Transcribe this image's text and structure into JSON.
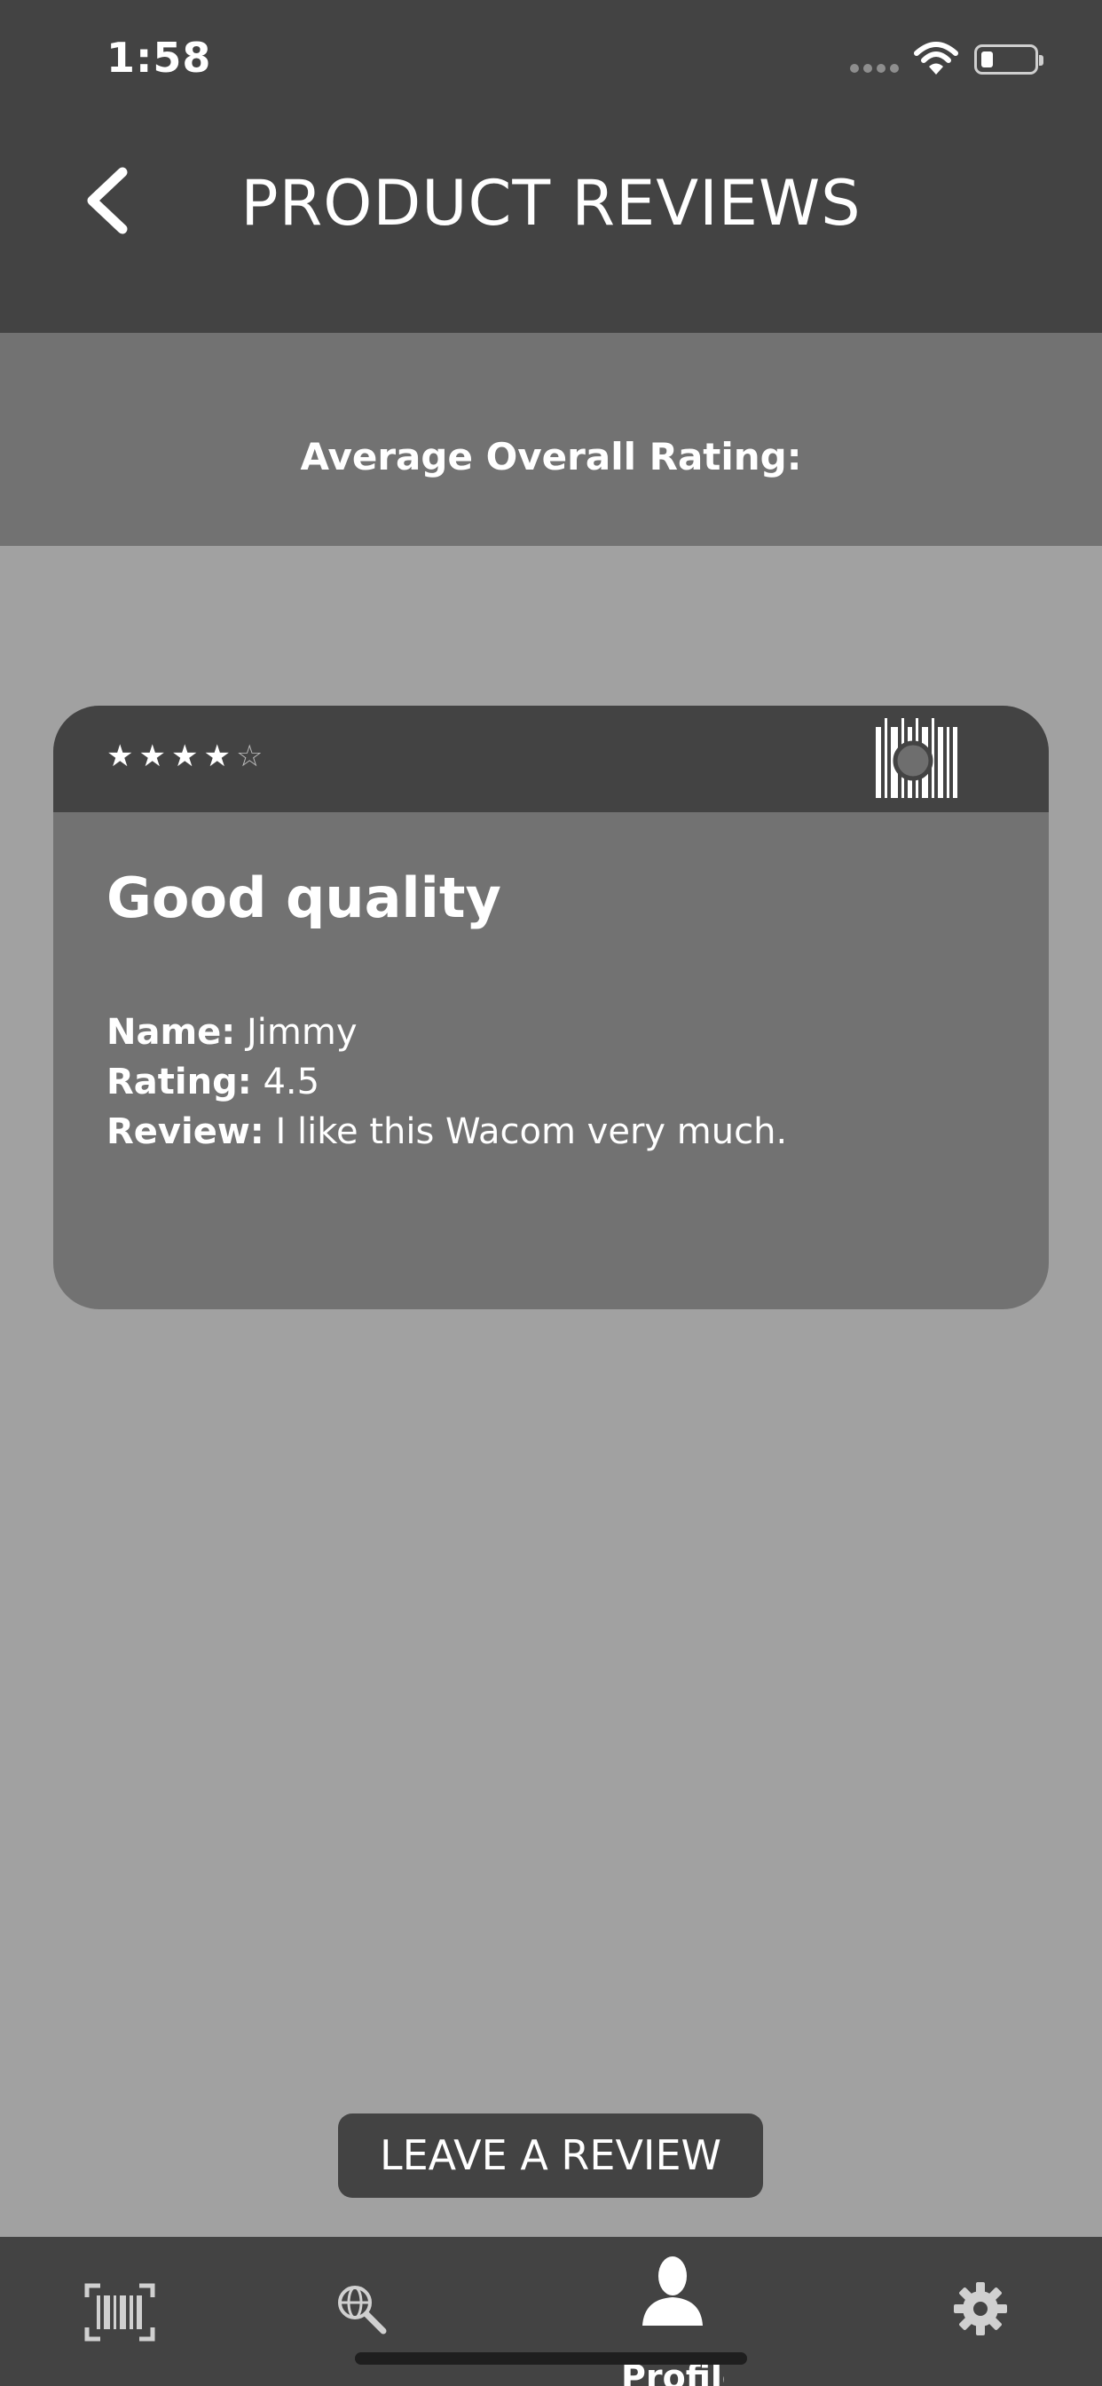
{
  "status_bar": {
    "time": "1:58"
  },
  "header": {
    "title": "PRODUCT REVIEWS"
  },
  "average": {
    "label": "Average Overall Rating:"
  },
  "review": {
    "stars_filled": 4,
    "stars_total": 5,
    "star_filled_glyph": "★",
    "star_empty_glyph": "☆",
    "title": "Good quality",
    "name_label": "Name:",
    "name_value": " Jimmy",
    "rating_label": "Rating:",
    "rating_value": " 4.5",
    "review_label": "Review:",
    "review_value": " I like this Wacom very much."
  },
  "actions": {
    "leave_review": "LEAVE A REVIEW"
  },
  "tabbar": {
    "items": [
      {
        "icon": "barcode-scan-icon"
      },
      {
        "icon": "globe-search-icon"
      },
      {
        "icon": "profile-icon",
        "label": "Profile"
      },
      {
        "icon": "gear-icon"
      }
    ]
  },
  "colors": {
    "background": "#a1a1a1",
    "header": "#434343",
    "band": "#727272",
    "card": "#727272"
  }
}
